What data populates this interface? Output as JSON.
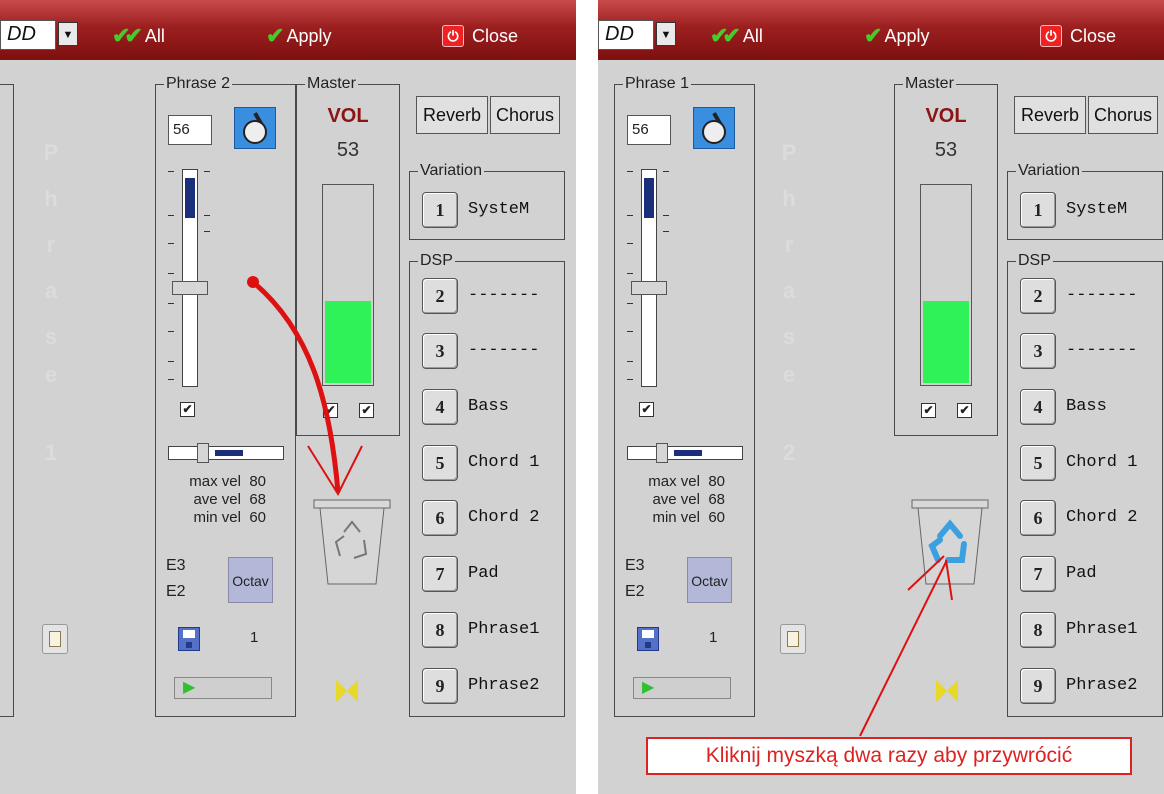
{
  "toolbar": {
    "dropdown_value": "DD",
    "all_label": "All",
    "apply_label": "Apply",
    "close_label": "Close"
  },
  "left": {
    "phrase_legend": "Phrase 2",
    "ghost_label": [
      "P",
      "h",
      "r",
      "a",
      "s",
      "e",
      "1"
    ],
    "program_number": "56",
    "velocity": {
      "max_label": "max vel",
      "max_value": "80",
      "ave_label": "ave vel",
      "ave_value": "68",
      "min_label": "min vel",
      "min_value": "60"
    },
    "note_high": "E3",
    "note_low": "E2",
    "octav_label": "Octav",
    "page_number": "1"
  },
  "right": {
    "phrase_legend": "Phrase 1",
    "ghost_label": [
      "P",
      "h",
      "r",
      "a",
      "s",
      "e",
      "2"
    ],
    "program_number": "56",
    "velocity": {
      "max_label": "max vel",
      "max_value": "80",
      "ave_label": "ave vel",
      "ave_value": "68",
      "min_label": "min vel",
      "min_value": "60"
    },
    "note_high": "E3",
    "note_low": "E2",
    "octav_label": "Octav",
    "page_number": "1",
    "callout_text": "Kliknij myszką dwa razy aby przywrócić"
  },
  "master": {
    "legend": "Master",
    "vol_label": "VOL",
    "vol_value": "53",
    "level_fraction": 0.42
  },
  "effects": {
    "reverb_label": "Reverb",
    "chorus_label": "Chorus",
    "variation_legend": "Variation",
    "variation": {
      "num": "1",
      "label": "SysteM"
    },
    "dsp_legend": "DSP",
    "dsp": [
      {
        "num": "2",
        "label": "-------"
      },
      {
        "num": "3",
        "label": "-------"
      },
      {
        "num": "4",
        "label": "Bass"
      },
      {
        "num": "5",
        "label": "Chord 1"
      },
      {
        "num": "6",
        "label": "Chord 2"
      },
      {
        "num": "7",
        "label": "Pad"
      },
      {
        "num": "8",
        "label": "Phrase1"
      },
      {
        "num": "9",
        "label": "Phrase2"
      }
    ]
  },
  "colors": {
    "toolbar_dark": "#7e1010",
    "meter_green": "#2ef257",
    "annotation_red": "#dd1111",
    "recycle_blue": "#3aa0e0"
  }
}
